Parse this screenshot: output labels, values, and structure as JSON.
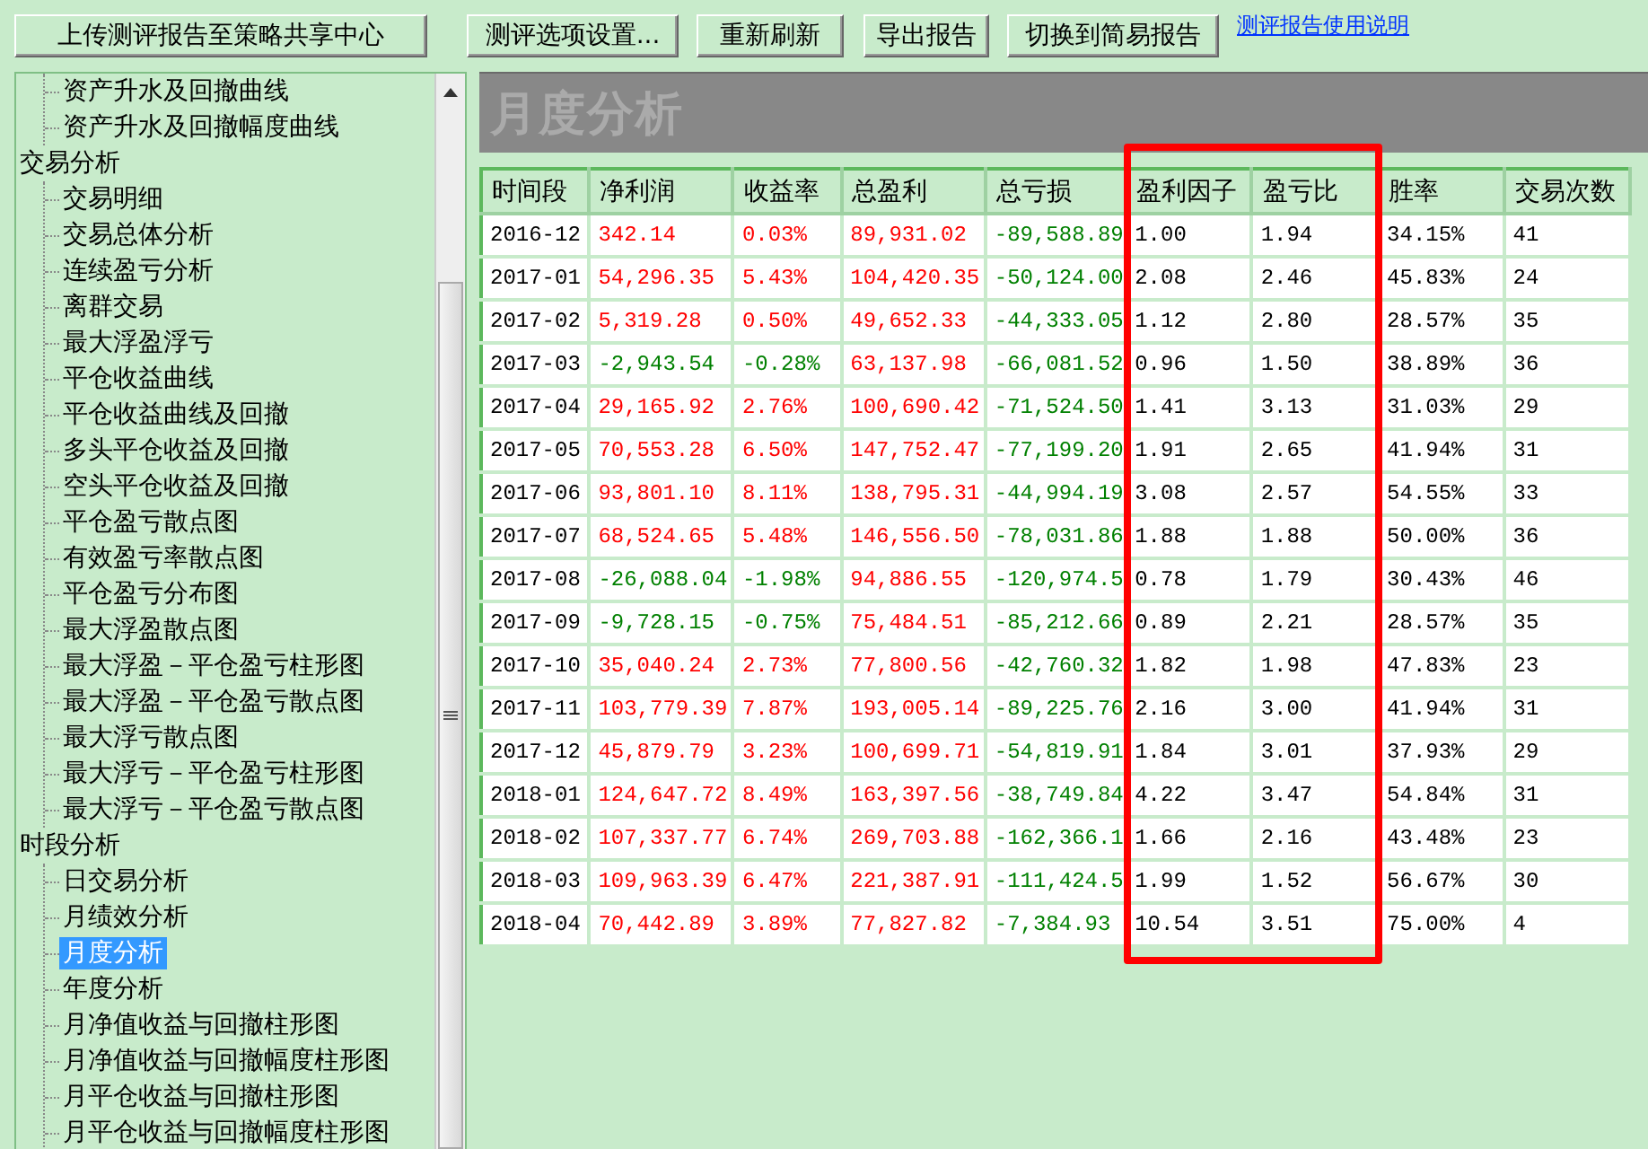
{
  "toolbar": {
    "buttons": [
      "上传测评报告至策略共享中心",
      "测评选项设置...",
      "重新刷新",
      "导出报告",
      "切换到简易报告"
    ],
    "link": "测评报告使用说明"
  },
  "tree": [
    {
      "children": [
        {
          "label": "资产升水及回撤曲线",
          "selected": false
        },
        {
          "label": "资产升水及回撤幅度曲线",
          "selected": false
        }
      ]
    },
    {
      "label": "交易分析",
      "children": [
        {
          "label": "交易明细",
          "selected": false
        },
        {
          "label": "交易总体分析",
          "selected": false
        },
        {
          "label": "连续盈亏分析",
          "selected": false
        },
        {
          "label": "离群交易",
          "selected": false
        },
        {
          "label": "最大浮盈浮亏",
          "selected": false
        },
        {
          "label": "平仓收益曲线",
          "selected": false
        },
        {
          "label": "平仓收益曲线及回撤",
          "selected": false
        },
        {
          "label": "多头平仓收益及回撤",
          "selected": false
        },
        {
          "label": "空头平仓收益及回撤",
          "selected": false
        },
        {
          "label": "平仓盈亏散点图",
          "selected": false
        },
        {
          "label": "有效盈亏率散点图",
          "selected": false
        },
        {
          "label": "平仓盈亏分布图",
          "selected": false
        },
        {
          "label": "最大浮盈散点图",
          "selected": false
        },
        {
          "label": "最大浮盈－平仓盈亏柱形图",
          "selected": false
        },
        {
          "label": "最大浮盈－平仓盈亏散点图",
          "selected": false
        },
        {
          "label": "最大浮亏散点图",
          "selected": false
        },
        {
          "label": "最大浮亏－平仓盈亏柱形图",
          "selected": false
        },
        {
          "label": "最大浮亏－平仓盈亏散点图",
          "selected": false
        }
      ]
    },
    {
      "label": "时段分析",
      "children": [
        {
          "label": "日交易分析",
          "selected": false
        },
        {
          "label": "月绩效分析",
          "selected": false
        },
        {
          "label": "月度分析",
          "selected": true
        },
        {
          "label": "年度分析",
          "selected": false
        },
        {
          "label": "月净值收益与回撤柱形图",
          "selected": false
        },
        {
          "label": "月净值收益与回撤幅度柱形图",
          "selected": false
        },
        {
          "label": "月平仓收益与回撤柱形图",
          "selected": false
        },
        {
          "label": "月平仓收益与回撤幅度柱形图",
          "selected": false
        }
      ]
    }
  ],
  "panel_title": "月度分析",
  "table": {
    "columns": [
      "时间段",
      "净利润",
      "收益率",
      "总盈利",
      "总亏损",
      "盈利因子",
      "盈亏比",
      "胜率",
      "交易次数"
    ],
    "rows": [
      {
        "loss": false,
        "cells": [
          "2016-12",
          "342.14",
          "0.03%",
          "89,931.02",
          "-89,588.89",
          "1.00",
          "1.94",
          "34.15%",
          "41"
        ]
      },
      {
        "loss": false,
        "cells": [
          "2017-01",
          "54,296.35",
          "5.43%",
          "104,420.35",
          "-50,124.00",
          "2.08",
          "2.46",
          "45.83%",
          "24"
        ]
      },
      {
        "loss": false,
        "cells": [
          "2017-02",
          "5,319.28",
          "0.50%",
          "49,652.33",
          "-44,333.05",
          "1.12",
          "2.80",
          "28.57%",
          "35"
        ]
      },
      {
        "loss": true,
        "cells": [
          "2017-03",
          "-2,943.54",
          "-0.28%",
          "63,137.98",
          "-66,081.52",
          "0.96",
          "1.50",
          "38.89%",
          "36"
        ]
      },
      {
        "loss": false,
        "cells": [
          "2017-04",
          "29,165.92",
          "2.76%",
          "100,690.42",
          "-71,524.50",
          "1.41",
          "3.13",
          "31.03%",
          "29"
        ]
      },
      {
        "loss": false,
        "cells": [
          "2017-05",
          "70,553.28",
          "6.50%",
          "147,752.47",
          "-77,199.20",
          "1.91",
          "2.65",
          "41.94%",
          "31"
        ]
      },
      {
        "loss": false,
        "cells": [
          "2017-06",
          "93,801.10",
          "8.11%",
          "138,795.31",
          "-44,994.19",
          "3.08",
          "2.57",
          "54.55%",
          "33"
        ]
      },
      {
        "loss": false,
        "cells": [
          "2017-07",
          "68,524.65",
          "5.48%",
          "146,556.50",
          "-78,031.86",
          "1.88",
          "1.88",
          "50.00%",
          "36"
        ]
      },
      {
        "loss": true,
        "cells": [
          "2017-08",
          "-26,088.04",
          "-1.98%",
          "94,886.55",
          "-120,974.5",
          "0.78",
          "1.79",
          "30.43%",
          "46"
        ]
      },
      {
        "loss": true,
        "cells": [
          "2017-09",
          "-9,728.15",
          "-0.75%",
          "75,484.51",
          "-85,212.66",
          "0.89",
          "2.21",
          "28.57%",
          "35"
        ]
      },
      {
        "loss": false,
        "cells": [
          "2017-10",
          "35,040.24",
          "2.73%",
          "77,800.56",
          "-42,760.32",
          "1.82",
          "1.98",
          "47.83%",
          "23"
        ]
      },
      {
        "loss": false,
        "cells": [
          "2017-11",
          "103,779.39",
          "7.87%",
          "193,005.14",
          "-89,225.76",
          "2.16",
          "3.00",
          "41.94%",
          "31"
        ]
      },
      {
        "loss": false,
        "cells": [
          "2017-12",
          "45,879.79",
          "3.23%",
          "100,699.71",
          "-54,819.91",
          "1.84",
          "3.01",
          "37.93%",
          "29"
        ]
      },
      {
        "loss": false,
        "cells": [
          "2018-01",
          "124,647.72",
          "8.49%",
          "163,397.56",
          "-38,749.84",
          "4.22",
          "3.47",
          "54.84%",
          "31"
        ]
      },
      {
        "loss": false,
        "cells": [
          "2018-02",
          "107,337.77",
          "6.74%",
          "269,703.88",
          "-162,366.1",
          "1.66",
          "2.16",
          "43.48%",
          "23"
        ]
      },
      {
        "loss": false,
        "cells": [
          "2018-03",
          "109,963.39",
          "6.47%",
          "221,387.91",
          "-111,424.5",
          "1.99",
          "1.52",
          "56.67%",
          "30"
        ]
      },
      {
        "loss": false,
        "cells": [
          "2018-04",
          "70,442.89",
          "3.89%",
          "77,827.82",
          "-7,384.93",
          "10.54",
          "3.51",
          "75.00%",
          "4"
        ]
      }
    ]
  },
  "highlight": {
    "on": true
  }
}
